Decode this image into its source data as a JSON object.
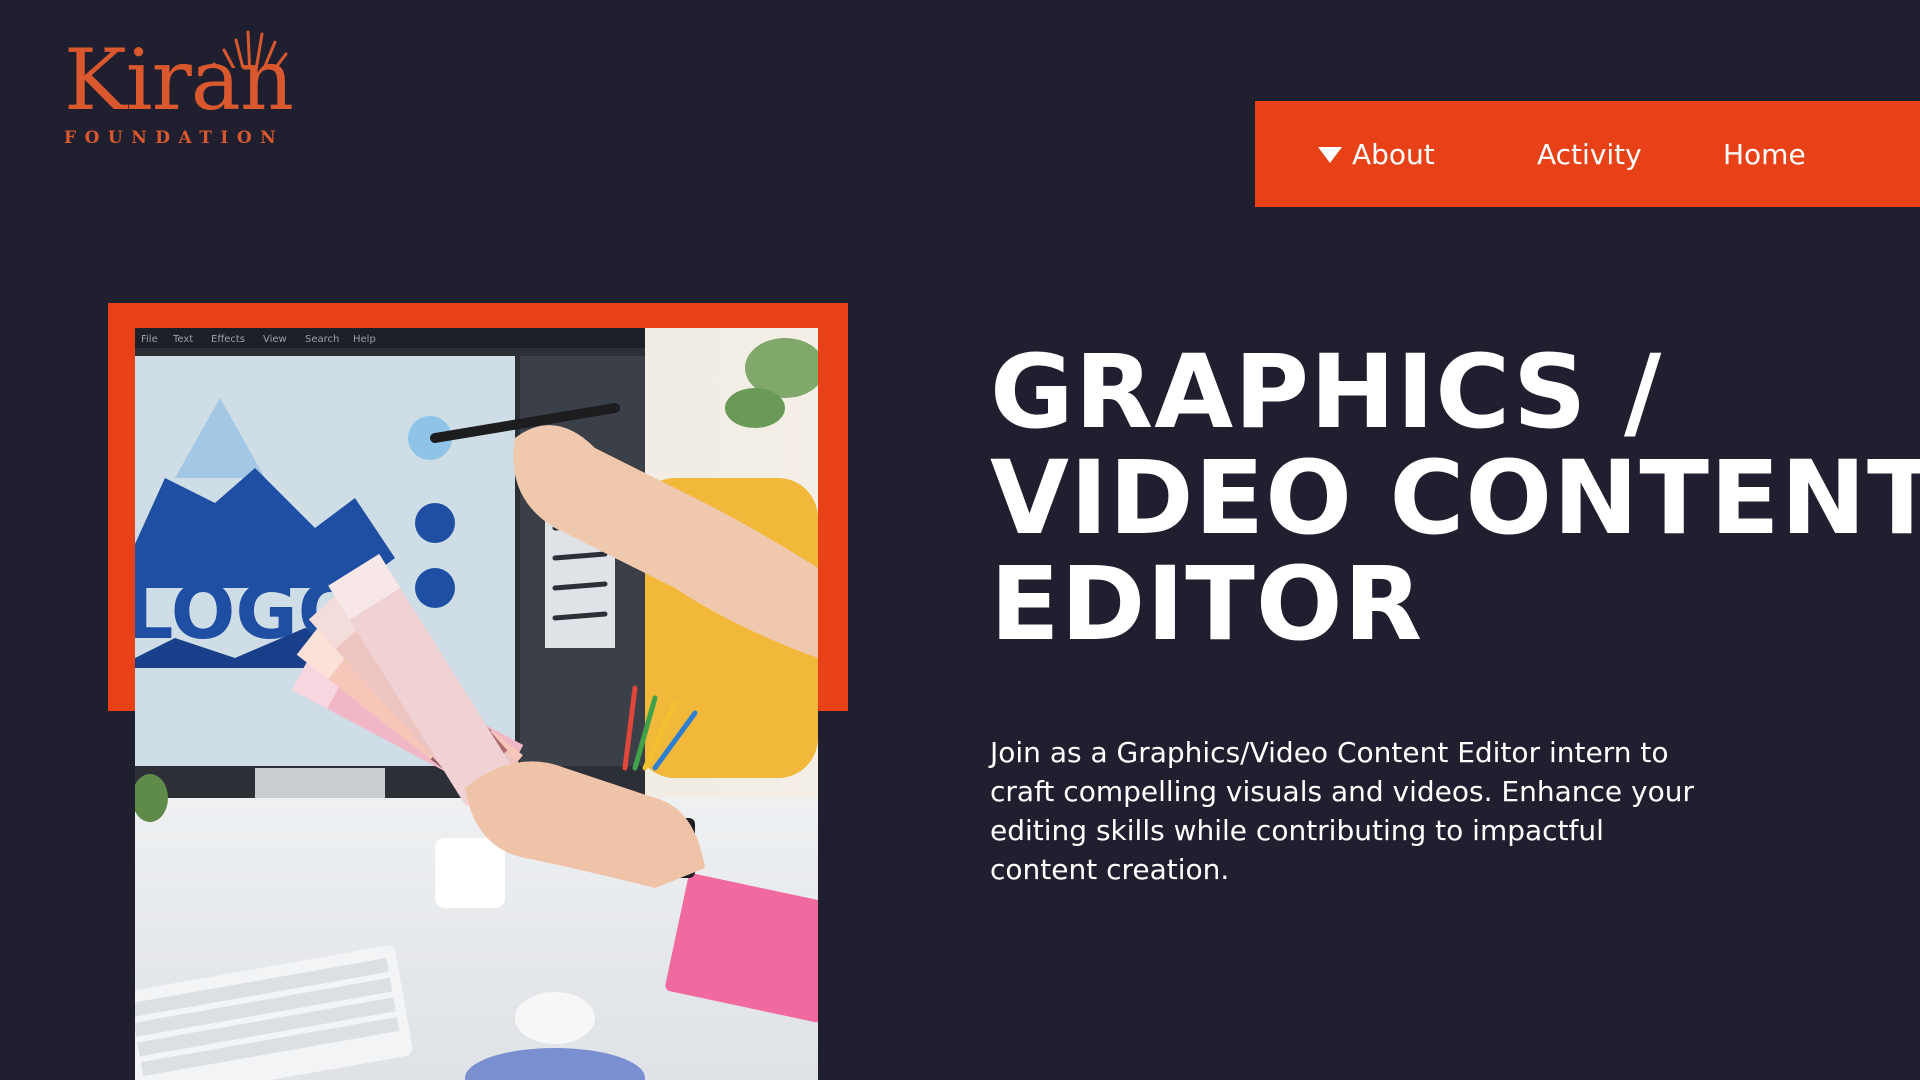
{
  "brand": {
    "name": "Kiran",
    "tagline": "FOUNDATION",
    "color": "#d9582d"
  },
  "nav": {
    "background": "#e84118",
    "items": [
      {
        "label": "About",
        "has_dropdown": true
      },
      {
        "label": "Activity"
      },
      {
        "label": "Home"
      }
    ]
  },
  "hero": {
    "title_lines": [
      "GRAPHICS /",
      "VIDEO CONTENT",
      "EDITOR"
    ],
    "description": "Join as a Graphics/Video Content Editor intern to craft compelling visuals and videos. Enhance your editing skills while contributing to impactful content creation.",
    "image": {
      "screen_text": "LOGO",
      "menu_items": [
        "File",
        "Text",
        "Effects",
        "View",
        "Search",
        "Help"
      ],
      "accent_frame_color": "#e84118"
    }
  },
  "colors": {
    "page_background": "#1f1f30",
    "text": "#ffffff"
  }
}
